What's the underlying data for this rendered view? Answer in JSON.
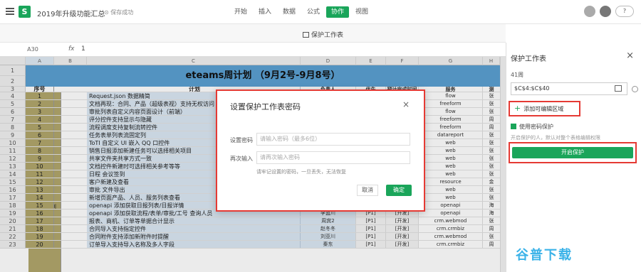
{
  "app": {
    "logo": "S",
    "doc_title": "2019年升级功能汇总",
    "save_status": "保存成功"
  },
  "tabs": [
    "开始",
    "插入",
    "数据",
    "公式",
    "协作",
    "视图"
  ],
  "active_tab": "协作",
  "help_label": "?",
  "toolbar": {
    "protect_label": "保护工作表"
  },
  "formula_bar": {
    "cell_ref": "A30",
    "fx": "fx",
    "value": "1"
  },
  "sheet": {
    "columns": [
      "A",
      "B",
      "C",
      "D",
      "E",
      "F",
      "G",
      "H"
    ],
    "title": "eteams周计划  （9月2号-9月8号）",
    "headers": {
      "seq": "序号",
      "type": "工作类型",
      "plan": "计划",
      "d": "负责人",
      "e": "优先",
      "f": "预计完成时间",
      "g": "服务",
      "h": "测"
    },
    "group_label": "本周计划",
    "rows": [
      {
        "n": "1",
        "seq": "",
        "plan": "",
        "d": "",
        "e": "",
        "f": "",
        "g": "",
        "h": ""
      },
      {
        "n": "2",
        "seq": "",
        "plan": "",
        "d": "",
        "e": "",
        "f": "",
        "g": "",
        "h": ""
      },
      {
        "n": "3",
        "seq": "序号",
        "plan": "计划",
        "d": "负责人",
        "e": "优先",
        "f": "预计完成时间",
        "g": "服务",
        "h": "测"
      },
      {
        "n": "4",
        "seq": "1",
        "plan": "Request.json 数据精简",
        "d": "",
        "e": "",
        "f": "",
        "g": "flow",
        "h": "张"
      },
      {
        "n": "5",
        "seq": "2",
        "plan": "文档再现：合同、产品（超级表视）支持无权访问",
        "d": "",
        "e": "",
        "f": "",
        "g": "freeform",
        "h": "张"
      },
      {
        "n": "6",
        "seq": "3",
        "plan": "审批列表自定义内容页面设计（前端）",
        "d": "",
        "e": "",
        "f": "",
        "g": "flow",
        "h": "张"
      },
      {
        "n": "7",
        "seq": "4",
        "plan": "评分控件支持显示与隐藏",
        "d": "",
        "e": "",
        "f": "",
        "g": "freeform",
        "h": "周"
      },
      {
        "n": "8",
        "seq": "5",
        "plan": "流程调度支持复制流转控件",
        "d": "",
        "e": "",
        "f": "",
        "g": "freeform",
        "h": "周"
      },
      {
        "n": "9",
        "seq": "6",
        "plan": "任务表单列表流固定列",
        "d": "",
        "e": "",
        "f": "",
        "g": "datareport",
        "h": "张"
      },
      {
        "n": "10",
        "seq": "7",
        "plan": "ToTI 自定义 UI 嵌入 QQ 口控件",
        "d": "",
        "e": "",
        "f": "",
        "g": "web",
        "h": "张"
      },
      {
        "n": "11",
        "seq": "8",
        "plan": "销售日报添加新建任务可以选择相关项目",
        "d": "",
        "e": "",
        "f": "",
        "g": "web",
        "h": "张"
      },
      {
        "n": "12",
        "seq": "9",
        "plan": "共享文件夹共享方式一致",
        "d": "",
        "e": "",
        "f": "",
        "g": "web",
        "h": "张"
      },
      {
        "n": "13",
        "seq": "10",
        "plan": "文档控件新建时可选择相关参考等等",
        "d": "",
        "e": "",
        "f": "",
        "g": "web",
        "h": "张"
      },
      {
        "n": "14",
        "seq": "11",
        "plan": "日程 会议签到",
        "d": "",
        "e": "",
        "f": "",
        "g": "web",
        "h": "张"
      },
      {
        "n": "15",
        "seq": "12",
        "plan": "客户新建及查看",
        "d": "李蓝川",
        "e": "[P1]",
        "f": "[开发]",
        "g": "resource",
        "h": "金"
      },
      {
        "n": "16",
        "seq": "13",
        "plan": "审批 文件导出",
        "d": "李蓝川",
        "e": "[P2]",
        "f": "[开发]",
        "g": "web",
        "h": "张"
      },
      {
        "n": "17",
        "seq": "14",
        "plan": "新增页面产品、人员、服务列表查看",
        "d": "李蓝川",
        "e": "[P1]",
        "f": "[开发]",
        "g": "web",
        "h": "张"
      },
      {
        "n": "18",
        "seq": "15",
        "plan": "openapi 添加获取日报列表/日报详情",
        "d": "李蓝川",
        "e": "[P1]",
        "f": "[开发]",
        "g": "openapi",
        "h": "海"
      },
      {
        "n": "19",
        "seq": "16",
        "plan": "openapi 添加获取流程/表单/审批/工号 查询人员",
        "d": "李蓝川",
        "e": "[P1]",
        "f": "[开发]",
        "g": "openapi",
        "h": "海"
      },
      {
        "n": "20",
        "seq": "17",
        "plan": "报表、商机、订单等单据合计显示",
        "d": "周宾2",
        "e": "[P1]",
        "f": "[开发]",
        "g": "crm.webmod",
        "h": "张"
      },
      {
        "n": "21",
        "seq": "18",
        "plan": "合同导入支持指定控件",
        "d": "赵冬冬",
        "e": "[P1]",
        "f": "[开发]",
        "g": "crm.crmbiz",
        "h": "周"
      },
      {
        "n": "22",
        "seq": "19",
        "plan": "合同附件支持添加新附件时提醒",
        "d": "刘亚川",
        "e": "[P1]",
        "f": "[开发]",
        "g": "crm.webmod",
        "h": "张"
      },
      {
        "n": "23",
        "seq": "20",
        "plan": "订单导入支持导入名称及多人字段",
        "d": "秦东",
        "e": "[P1]",
        "f": "[开发]",
        "g": "crm.crmbiz",
        "h": "周"
      }
    ]
  },
  "dialog": {
    "title": "设置保护工作表密码",
    "close": "×",
    "password_label": "设置密码",
    "password_placeholder": "请输入密码（最多6位）",
    "confirm_label": "再次输入",
    "confirm_placeholder": "请再次输入密码",
    "hint": "请牢记设置的密码，一旦丢失，无法恢复",
    "cancel": "取消",
    "ok": "确定"
  },
  "side_panel": {
    "title": "保护工作表",
    "close": "×",
    "sheet_name": "41周",
    "range": "$C$4:$C$40",
    "add_label": "添加可编辑区域",
    "use_password": "使用密码保护",
    "desc": "开启保护的人，默认对整个表格编辑权限",
    "start_button": "开启保护"
  },
  "watermark": "谷普下载"
}
